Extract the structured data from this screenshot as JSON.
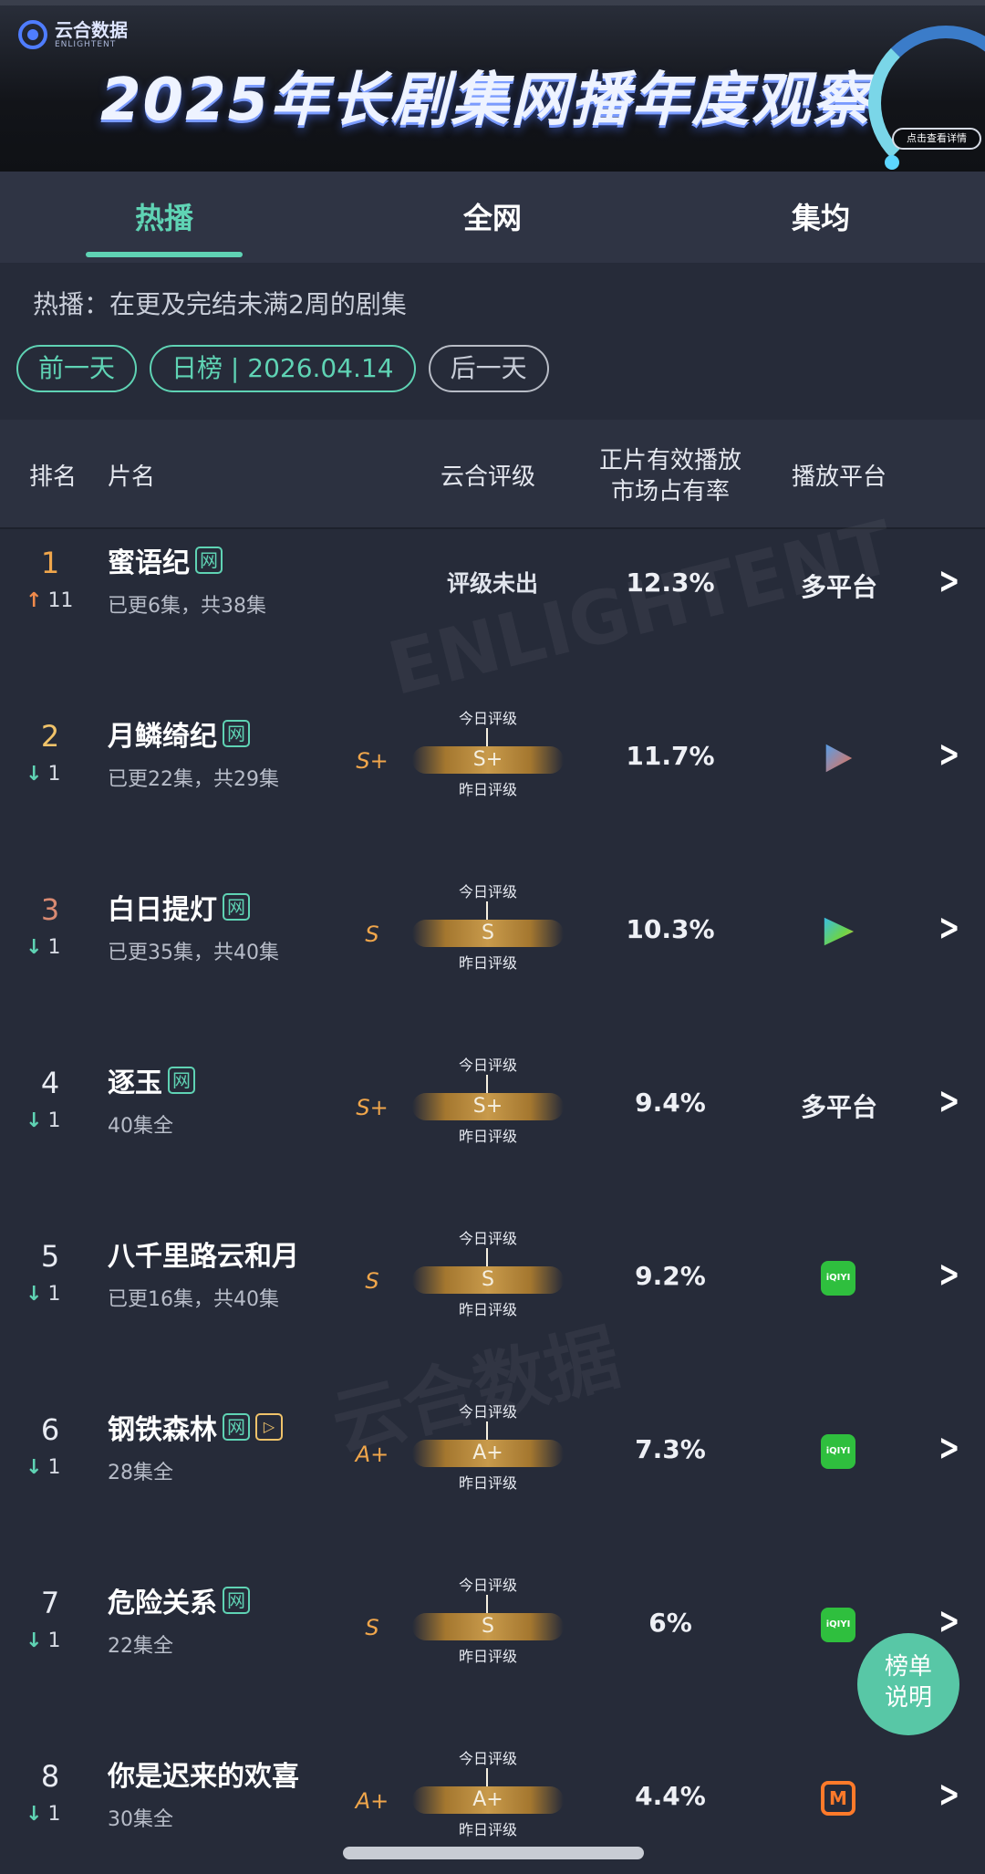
{
  "banner": {
    "logo_cn": "云合数据",
    "logo_en": "ENLIGHTENT",
    "title": "2025年长剧集网播年度观察",
    "detail_button": "点击查看详情"
  },
  "tabs": [
    {
      "label": "热播",
      "active": true
    },
    {
      "label": "全网",
      "active": false
    },
    {
      "label": "集均",
      "active": false
    }
  ],
  "note": "热播：在更及完结未满2周的剧集",
  "date_nav": {
    "prev": "前一天",
    "current": "日榜 | 2026.04.14",
    "next": "后一天"
  },
  "table_header": {
    "rank": "排名",
    "title": "片名",
    "rating": "云合评级",
    "share_line1": "正片有效播放",
    "share_line2": "市场占有率",
    "platform": "播放平台"
  },
  "labels": {
    "today_rating": "今日评级",
    "yesterday_rating": "昨日评级",
    "net_tag": "网"
  },
  "rows": [
    {
      "rank": "1",
      "dir": "up",
      "change": "11",
      "title": "蜜语纪",
      "episodes": "已更6集，共38集",
      "grade": "",
      "rating_text": "评级未出",
      "share": "12.3%",
      "platform": "多平台",
      "icon": ""
    },
    {
      "rank": "2",
      "dir": "down",
      "change": "1",
      "title": "月鳞绮纪",
      "episodes": "已更22集，共29集",
      "grade": "S+",
      "bar": "S+",
      "share": "11.7%",
      "platform": "",
      "icon": "youku-icon"
    },
    {
      "rank": "3",
      "dir": "down",
      "change": "1",
      "title": "白日提灯",
      "episodes": "已更35集，共40集",
      "grade": "S",
      "bar": "S",
      "share": "10.3%",
      "platform": "",
      "icon": "tencent-video-icon"
    },
    {
      "rank": "4",
      "dir": "down",
      "change": "1",
      "title": "逐玉",
      "episodes": "40集全",
      "grade": "S+",
      "bar": "S+",
      "share": "9.4%",
      "platform": "多平台",
      "icon": ""
    },
    {
      "rank": "5",
      "dir": "down",
      "change": "1",
      "title": "八千里路云和月",
      "episodes": "已更16集，共40集",
      "grade": "S",
      "bar": "S",
      "share": "9.2%",
      "platform": "",
      "icon": "iqiyi-icon"
    },
    {
      "rank": "6",
      "dir": "down",
      "change": "1",
      "title": "钢铁森林",
      "episodes": "28集全",
      "grade": "A+",
      "bar": "A+",
      "share": "7.3%",
      "platform": "",
      "icon": "iqiyi-icon"
    },
    {
      "rank": "7",
      "dir": "down",
      "change": "1",
      "title": "危险关系",
      "episodes": "22集全",
      "grade": "S",
      "bar": "S",
      "share": "6%",
      "platform": "",
      "icon": "iqiyi-icon"
    },
    {
      "rank": "8",
      "dir": "down",
      "change": "1",
      "title": "你是迟来的欢喜",
      "episodes": "30集全",
      "grade": "A+",
      "bar": "A+",
      "share": "4.4%",
      "platform": "",
      "icon": "mango-tv-icon"
    }
  ],
  "help_fab": {
    "line1": "榜单",
    "line2": "说明"
  },
  "colors": {
    "accent": "#5fd3b4",
    "rank_up": "#f08a4b",
    "grade": "#f0a64b",
    "background": "#262b39"
  }
}
